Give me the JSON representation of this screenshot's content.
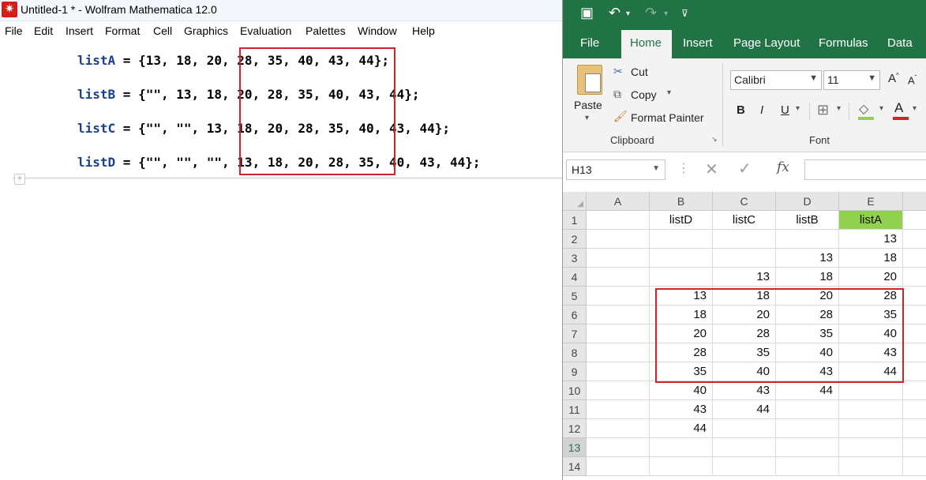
{
  "mathematica": {
    "title": "Untitled-1 * - Wolfram Mathematica 12.0",
    "menu": [
      "File",
      "Edit",
      "Insert",
      "Format",
      "Cell",
      "Graphics",
      "Evaluation",
      "Palettes",
      "Window",
      "Help"
    ],
    "lines": [
      {
        "name": "listA",
        "text": " = {13, 18, 20, 28, 35, 40, 43, 44};"
      },
      {
        "name": "listB",
        "text": " = {\"\", 13, 18, 20, 28, 35, 40, 43, 44};"
      },
      {
        "name": "listC",
        "text": " = {\"\", \"\", 13, 18, 20, 28, 35, 40, 43, 44};"
      },
      {
        "name": "listD",
        "text": " = {\"\", \"\", \"\", 13, 18, 20, 28, 35, 40, 43, 44};"
      }
    ],
    "highlight_color": "#d0242a"
  },
  "excel": {
    "tabs": [
      "File",
      "Home",
      "Insert",
      "Page Layout",
      "Formulas",
      "Data"
    ],
    "active_tab": "Home",
    "clipboard": {
      "paste": "Paste",
      "cut": "Cut",
      "copy": "Copy",
      "format_painter": "Format Painter",
      "group": "Clipboard"
    },
    "font": {
      "name": "Calibri",
      "size": "11",
      "group": "Font",
      "bold": "B",
      "italic": "I",
      "underline": "U"
    },
    "name_box": "H13",
    "fx": "fx",
    "columns": [
      "A",
      "B",
      "C",
      "D",
      "E"
    ],
    "rows": [
      "1",
      "2",
      "3",
      "4",
      "5",
      "6",
      "7",
      "8",
      "9",
      "10",
      "11",
      "12",
      "13",
      "14"
    ],
    "header_cells": {
      "B": "listD",
      "C": "listC",
      "D": "listB",
      "E": "listA"
    },
    "grid": [
      [
        "",
        "",
        "",
        "",
        "13"
      ],
      [
        "",
        "",
        "",
        "13",
        "18"
      ],
      [
        "",
        "",
        "13",
        "18",
        "20"
      ],
      [
        "",
        "13",
        "18",
        "20",
        "28"
      ],
      [
        "",
        "18",
        "20",
        "28",
        "35"
      ],
      [
        "",
        "20",
        "28",
        "35",
        "40"
      ],
      [
        "",
        "28",
        "35",
        "40",
        "43"
      ],
      [
        "",
        "35",
        "40",
        "43",
        "44"
      ],
      [
        "",
        "40",
        "43",
        "44",
        ""
      ],
      [
        "",
        "43",
        "44",
        "",
        ""
      ],
      [
        "",
        "44",
        "",
        "",
        ""
      ],
      [
        "",
        "",
        "",
        "",
        ""
      ],
      [
        "",
        "",
        "",
        "",
        ""
      ]
    ],
    "accent_color": "#217346",
    "highlight_header_color": "#92d050"
  }
}
